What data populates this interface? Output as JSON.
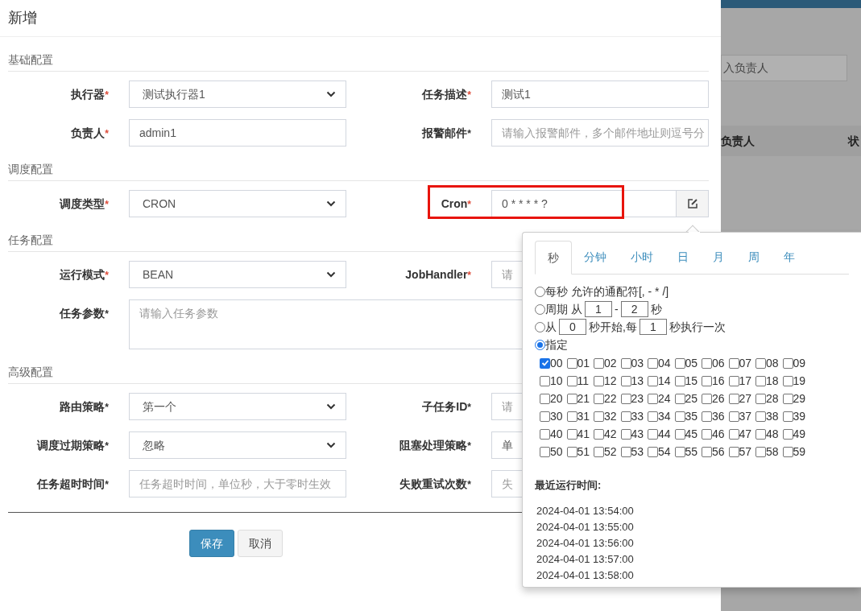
{
  "dialog": {
    "title": "新增",
    "sections": [
      {
        "title": "基础配置",
        "rows": [
          [
            {
              "label": "执行器",
              "mark": "*",
              "mark_red": true,
              "kind": "select",
              "value": "测试执行器1"
            },
            {
              "label": "任务描述",
              "mark": "*",
              "mark_red": true,
              "kind": "input",
              "value": "测试1"
            }
          ],
          [
            {
              "label": "负责人",
              "mark": "*",
              "mark_red": true,
              "kind": "input",
              "value": "admin1"
            },
            {
              "label": "报警邮件",
              "mark": "*",
              "mark_red": false,
              "kind": "input",
              "placeholder": "请输入报警邮件，多个邮件地址则逗号分"
            }
          ]
        ]
      },
      {
        "title": "调度配置",
        "rows": [
          [
            {
              "label": "调度类型",
              "mark": "*",
              "mark_red": true,
              "kind": "select",
              "value": "CRON"
            },
            {
              "label": "Cron",
              "mark": "*",
              "mark_red": true,
              "kind": "cron",
              "value": "0 * * * * ?",
              "highlighted": true
            }
          ]
        ]
      },
      {
        "title": "任务配置",
        "rows": [
          [
            {
              "label": "运行模式",
              "mark": "*",
              "mark_red": true,
              "kind": "select",
              "value": "BEAN"
            },
            {
              "label": "JobHandler",
              "mark": "*",
              "mark_red": true,
              "kind": "input",
              "placeholder": "请"
            }
          ],
          [
            {
              "label": "任务参数",
              "mark": "*",
              "mark_red": false,
              "kind": "textarea",
              "placeholder": "请输入任务参数"
            }
          ]
        ]
      },
      {
        "title": "高级配置",
        "rows": [
          [
            {
              "label": "路由策略",
              "mark": "*",
              "mark_red": false,
              "kind": "select",
              "value": "第一个"
            },
            {
              "label": "子任务ID",
              "mark": "*",
              "mark_red": false,
              "kind": "input",
              "placeholder": "请"
            }
          ],
          [
            {
              "label": "调度过期策略",
              "mark": "*",
              "mark_red": false,
              "kind": "select",
              "value": "忽略"
            },
            {
              "label": "阻塞处理策略",
              "mark": "*",
              "mark_red": false,
              "kind": "input",
              "value": "单"
            }
          ],
          [
            {
              "label": "任务超时时间",
              "mark": "*",
              "mark_red": false,
              "kind": "input",
              "placeholder": "任务超时时间，单位秒，大于零时生效"
            },
            {
              "label": "失败重试次数",
              "mark": "*",
              "mark_red": false,
              "kind": "input",
              "placeholder": "失"
            }
          ]
        ]
      }
    ],
    "buttons": [
      {
        "label": "保存",
        "kind": "primary"
      },
      {
        "label": "取消",
        "kind": "default"
      }
    ]
  },
  "cron_popover": {
    "tabs": [
      {
        "label": "秒",
        "selected": true
      },
      {
        "label": "分钟",
        "selected": false
      },
      {
        "label": "小时",
        "selected": false
      },
      {
        "label": "日",
        "selected": false
      },
      {
        "label": "月",
        "selected": false
      },
      {
        "label": "周",
        "selected": false
      },
      {
        "label": "年",
        "selected": false
      }
    ],
    "modes": [
      {
        "selected": false,
        "parts": [
          {
            "kind": "text",
            "text": "每秒 允许的通配符[, - * /]"
          }
        ]
      },
      {
        "selected": false,
        "parts": [
          {
            "kind": "text",
            "text": "周期 从"
          },
          {
            "kind": "input",
            "text": "1"
          },
          {
            "kind": "text",
            "text": "-"
          },
          {
            "kind": "input",
            "text": "2"
          },
          {
            "kind": "text",
            "text": "秒"
          }
        ]
      },
      {
        "selected": false,
        "parts": [
          {
            "kind": "text",
            "text": "从"
          },
          {
            "kind": "input",
            "text": "0"
          },
          {
            "kind": "text",
            "text": "秒开始,每"
          },
          {
            "kind": "input",
            "text": "1"
          },
          {
            "kind": "text",
            "text": "秒执行一次"
          }
        ]
      },
      {
        "selected": true,
        "parts": [
          {
            "kind": "text",
            "text": "指定"
          }
        ]
      }
    ],
    "seconds": [
      {
        "label": "00",
        "checked": true
      },
      {
        "label": "01",
        "checked": false
      },
      {
        "label": "02",
        "checked": false
      },
      {
        "label": "03",
        "checked": false
      },
      {
        "label": "04",
        "checked": false
      },
      {
        "label": "05",
        "checked": false
      },
      {
        "label": "06",
        "checked": false
      },
      {
        "label": "07",
        "checked": false
      },
      {
        "label": "08",
        "checked": false
      },
      {
        "label": "09",
        "checked": false
      },
      {
        "label": "10",
        "checked": false
      },
      {
        "label": "11",
        "checked": false
      },
      {
        "label": "12",
        "checked": false
      },
      {
        "label": "13",
        "checked": false
      },
      {
        "label": "14",
        "checked": false
      },
      {
        "label": "15",
        "checked": false
      },
      {
        "label": "16",
        "checked": false
      },
      {
        "label": "17",
        "checked": false
      },
      {
        "label": "18",
        "checked": false
      },
      {
        "label": "19",
        "checked": false
      },
      {
        "label": "20",
        "checked": false
      },
      {
        "label": "21",
        "checked": false
      },
      {
        "label": "22",
        "checked": false
      },
      {
        "label": "23",
        "checked": false
      },
      {
        "label": "24",
        "checked": false
      },
      {
        "label": "25",
        "checked": false
      },
      {
        "label": "26",
        "checked": false
      },
      {
        "label": "27",
        "checked": false
      },
      {
        "label": "28",
        "checked": false
      },
      {
        "label": "29",
        "checked": false
      },
      {
        "label": "30",
        "checked": false
      },
      {
        "label": "31",
        "checked": false
      },
      {
        "label": "32",
        "checked": false
      },
      {
        "label": "33",
        "checked": false
      },
      {
        "label": "34",
        "checked": false
      },
      {
        "label": "35",
        "checked": false
      },
      {
        "label": "36",
        "checked": false
      },
      {
        "label": "37",
        "checked": false
      },
      {
        "label": "38",
        "checked": false
      },
      {
        "label": "39",
        "checked": false
      },
      {
        "label": "40",
        "checked": false
      },
      {
        "label": "41",
        "checked": false
      },
      {
        "label": "42",
        "checked": false
      },
      {
        "label": "43",
        "checked": false
      },
      {
        "label": "44",
        "checked": false
      },
      {
        "label": "45",
        "checked": false
      },
      {
        "label": "46",
        "checked": false
      },
      {
        "label": "47",
        "checked": false
      },
      {
        "label": "48",
        "checked": false
      },
      {
        "label": "49",
        "checked": false
      },
      {
        "label": "50",
        "checked": false
      },
      {
        "label": "51",
        "checked": false
      },
      {
        "label": "52",
        "checked": false
      },
      {
        "label": "53",
        "checked": false
      },
      {
        "label": "54",
        "checked": false
      },
      {
        "label": "55",
        "checked": false
      },
      {
        "label": "56",
        "checked": false
      },
      {
        "label": "57",
        "checked": false
      },
      {
        "label": "58",
        "checked": false
      },
      {
        "label": "59",
        "checked": false
      }
    ],
    "recent_runs": {
      "title": "最近运行时间:",
      "times": [
        "2024-04-01 13:54:00",
        "2024-04-01 13:55:00",
        "2024-04-01 13:56:00",
        "2024-04-01 13:57:00",
        "2024-04-01 13:58:00"
      ]
    }
  },
  "background_page": {
    "search_placeholder": "入负责人",
    "columns": [
      "负责人",
      "状"
    ]
  }
}
